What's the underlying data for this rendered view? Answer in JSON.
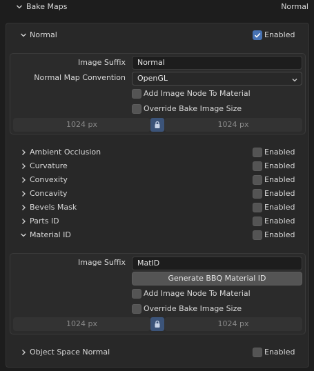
{
  "header": {
    "title": "Bake Maps",
    "right_value": "Normal"
  },
  "normal": {
    "title": "Normal",
    "enabled_label": "Enabled",
    "enabled": true,
    "image_suffix_label": "Image Suffix",
    "image_suffix_value": "Normal",
    "convention_label": "Normal Map Convention",
    "convention_value": "OpenGL",
    "add_image_node_label": "Add Image Node To Material",
    "override_size_label": "Override Bake Image Size",
    "width_value": "1024 px",
    "height_value": "1024 px"
  },
  "maps": [
    {
      "label": "Ambient Occlusion",
      "enabled_label": "Enabled"
    },
    {
      "label": "Curvature",
      "enabled_label": "Enabled"
    },
    {
      "label": "Convexity",
      "enabled_label": "Enabled"
    },
    {
      "label": "Concavity",
      "enabled_label": "Enabled"
    },
    {
      "label": "Bevels Mask",
      "enabled_label": "Enabled"
    },
    {
      "label": "Parts ID",
      "enabled_label": "Enabled"
    }
  ],
  "material_id": {
    "title": "Material ID",
    "enabled_label": "Enabled",
    "image_suffix_label": "Image Suffix",
    "image_suffix_value": "MatID",
    "generate_button_label": "Generate BBQ Material ID",
    "add_image_node_label": "Add Image Node To Material",
    "override_size_label": "Override Bake Image Size",
    "width_value": "1024 px",
    "height_value": "1024 px"
  },
  "object_space_normal": {
    "title": "Object Space Normal",
    "enabled_label": "Enabled"
  }
}
